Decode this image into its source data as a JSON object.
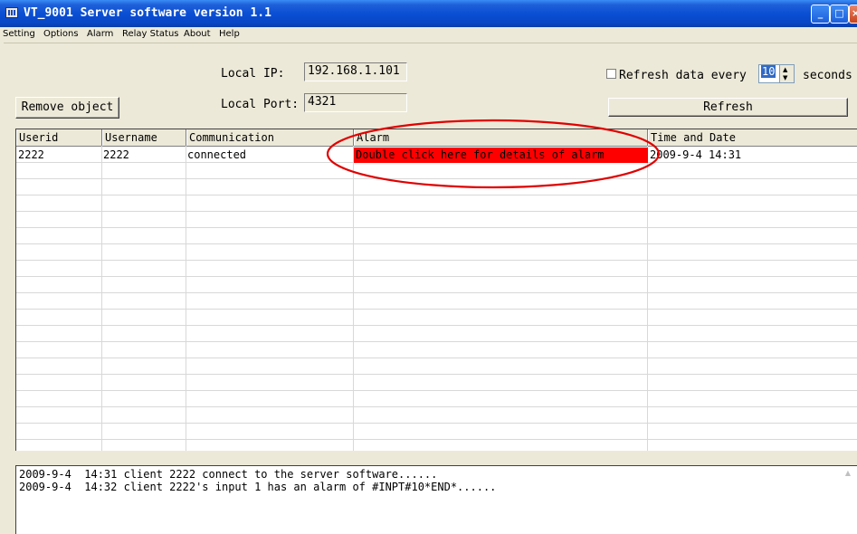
{
  "window": {
    "title": "VT_9001 Server software version 1.1",
    "minimize_glyph": "_",
    "maximize_glyph": "□",
    "close_glyph": "×"
  },
  "menu": [
    "Setting",
    "Options",
    "Alarm",
    "Relay Status",
    "About",
    "Help"
  ],
  "network": {
    "ip_label": "Local   IP:",
    "ip_value": "192.168.1.101",
    "port_label": "Local Port:",
    "port_value": "4321"
  },
  "refresh": {
    "checkbox_label": "Refresh data every",
    "checked": false,
    "interval": "10",
    "unit_label": "seconds",
    "button_label": "Refresh"
  },
  "remove_button_label": "Remove object",
  "table": {
    "columns": [
      "Userid",
      "Username",
      "Communication",
      "Alarm",
      "Time and Date"
    ],
    "rows": [
      {
        "userid": "2222",
        "username": "2222",
        "communication": "connected",
        "alarm": "Double click here for details of alarm",
        "time": "2009-9-4  14:31"
      }
    ],
    "alarm_highlight_color": "#ff0000",
    "annotation_color": "#e00000"
  },
  "log": [
    "2009-9-4  14:31 client 2222 connect to the server software......",
    "2009-9-4  14:32 client 2222's input 1 has an alarm of #INPT#10*END*......"
  ],
  "icons": {
    "app": "app-icon",
    "spinner_up": "▲",
    "spinner_down": "▼",
    "scroll_up": "▲"
  }
}
